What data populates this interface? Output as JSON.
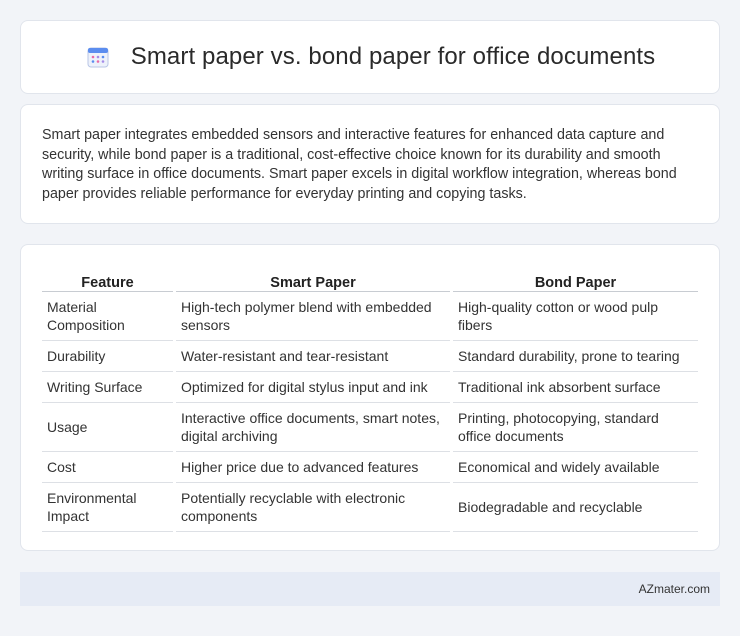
{
  "header": {
    "icon": "calendar-icon",
    "title": "Smart paper vs. bond paper for office documents"
  },
  "intro": {
    "text": "Smart paper integrates embedded sensors and interactive features for enhanced data capture and security, while bond paper is a traditional, cost-effective choice known for its durability and smooth writing surface in office documents. Smart paper excels in digital workflow integration, whereas bond paper provides reliable performance for everyday printing and copying tasks."
  },
  "table": {
    "headers": [
      "Feature",
      "Smart Paper",
      "Bond Paper"
    ],
    "rows": [
      [
        "Material Composition",
        "High-tech polymer blend with embedded sensors",
        "High-quality cotton or wood pulp fibers"
      ],
      [
        "Durability",
        "Water-resistant and tear-resistant",
        "Standard durability, prone to tearing"
      ],
      [
        "Writing Surface",
        "Optimized for digital stylus input and ink",
        "Traditional ink absorbent surface"
      ],
      [
        "Usage",
        "Interactive office documents, smart notes, digital archiving",
        "Printing, photocopying, standard office documents"
      ],
      [
        "Cost",
        "Higher price due to advanced features",
        "Economical and widely available"
      ],
      [
        "Environmental Impact",
        "Potentially recyclable with electronic components",
        "Biodegradable and recyclable"
      ]
    ]
  },
  "footer": {
    "site": "AZmater.com"
  },
  "colors": {
    "background": "#f2f4f8",
    "card": "#ffffff",
    "footer": "#e6ebf5",
    "icon_blue": "#5b8def",
    "icon_pink": "#e96aa8"
  }
}
